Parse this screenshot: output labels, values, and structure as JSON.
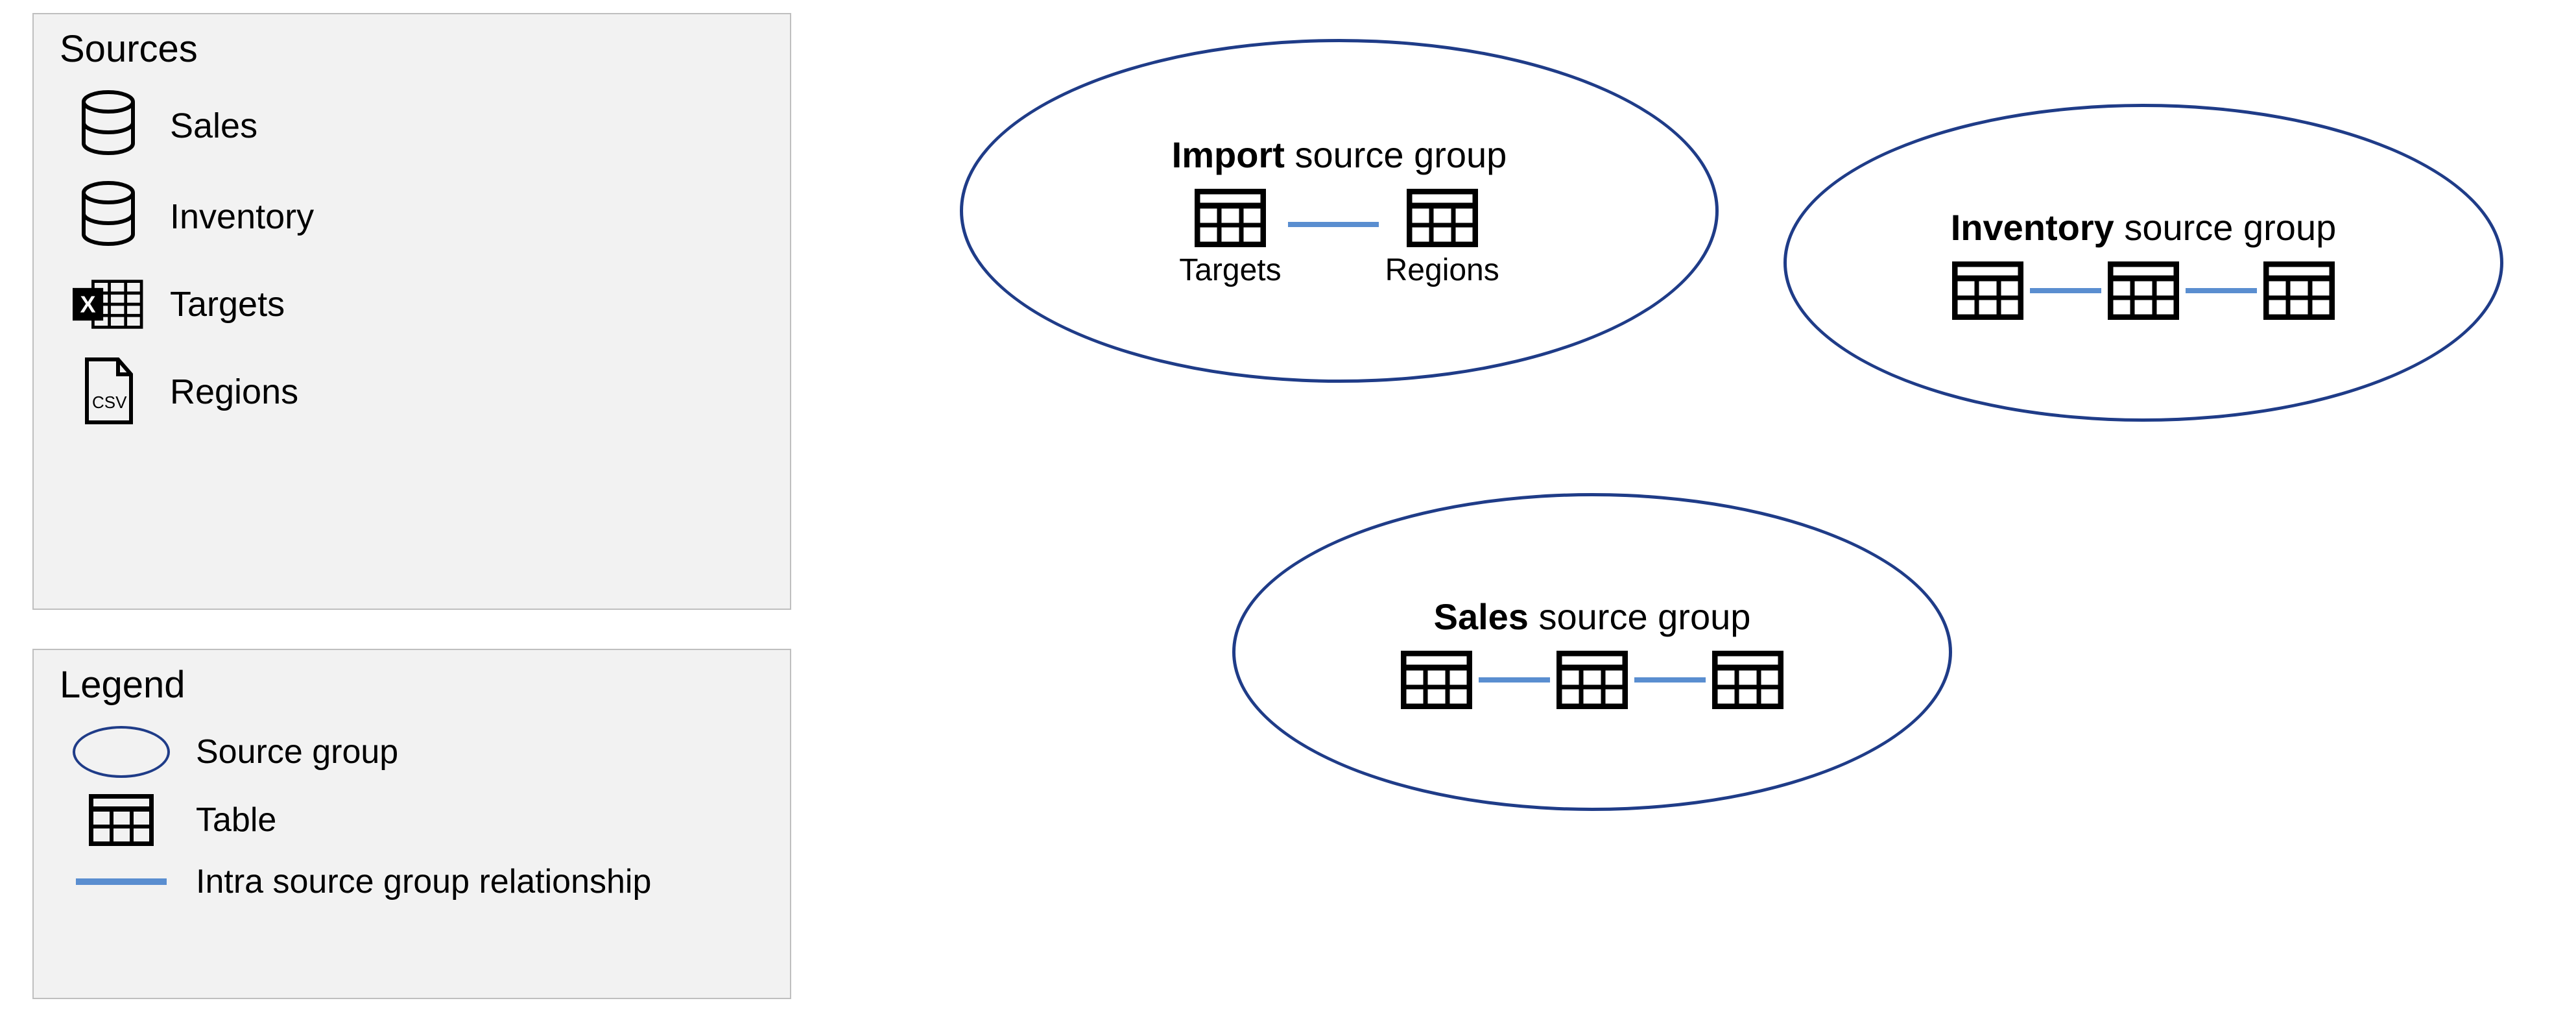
{
  "sources": {
    "title": "Sources",
    "items": [
      {
        "icon": "database",
        "label": "Sales"
      },
      {
        "icon": "database",
        "label": "Inventory"
      },
      {
        "icon": "excel",
        "label": "Targets"
      },
      {
        "icon": "csv",
        "label": "Regions"
      }
    ]
  },
  "legend": {
    "title": "Legend",
    "items": [
      {
        "symbol": "ellipse",
        "label": "Source group"
      },
      {
        "symbol": "table",
        "label": "Table"
      },
      {
        "symbol": "line",
        "label": "Intra source group relationship"
      }
    ]
  },
  "groups": {
    "import": {
      "title_bold": "Import",
      "title_rest": " source group",
      "tables": [
        "Targets",
        "Regions"
      ]
    },
    "inventory": {
      "title_bold": "Inventory",
      "title_rest": " source group",
      "table_count": 3
    },
    "sales": {
      "title_bold": "Sales",
      "title_rest": " source group",
      "table_count": 3
    }
  }
}
